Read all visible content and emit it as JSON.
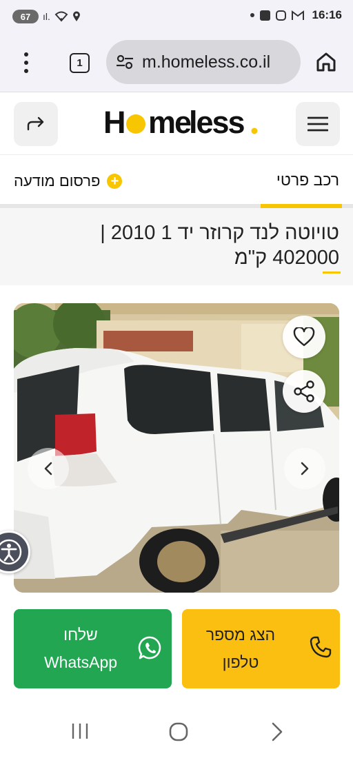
{
  "status_bar": {
    "battery": "67",
    "signal_text": "ıl.",
    "time": "16:16"
  },
  "browser": {
    "tab_count": "1",
    "url": "m.homeless.co.il"
  },
  "site": {
    "logo_text": "Homeless",
    "logo_dot": ".",
    "brand_color": "#f7c600"
  },
  "tabs": {
    "active": "רכב פרטי",
    "post_ad": "פרסום מודעה"
  },
  "listing": {
    "title": "טויוטה לנד קרוזר יד 1 2010 | 402000 ק\"מ"
  },
  "actions": {
    "whatsapp_line1": "שלחו",
    "whatsapp_line2": "WhatsApp",
    "phone_line1": "הצג מספר",
    "phone_line2": "טלפון",
    "whatsapp_color": "#22a652",
    "phone_color": "#fbbf11"
  },
  "icons": [
    "battery-icon",
    "wifi-icon",
    "location-icon",
    "checkbox-icon",
    "instagram-icon",
    "gmail-icon",
    "kebab-menu-icon",
    "site-settings-icon",
    "home-icon",
    "share-icon",
    "hamburger-icon",
    "plus-icon",
    "heart-icon",
    "share-nodes-icon",
    "chevron-left-icon",
    "chevron-right-icon",
    "accessibility-icon",
    "whatsapp-icon",
    "phone-icon",
    "recent-apps-icon",
    "home-circle-icon",
    "back-icon"
  ]
}
